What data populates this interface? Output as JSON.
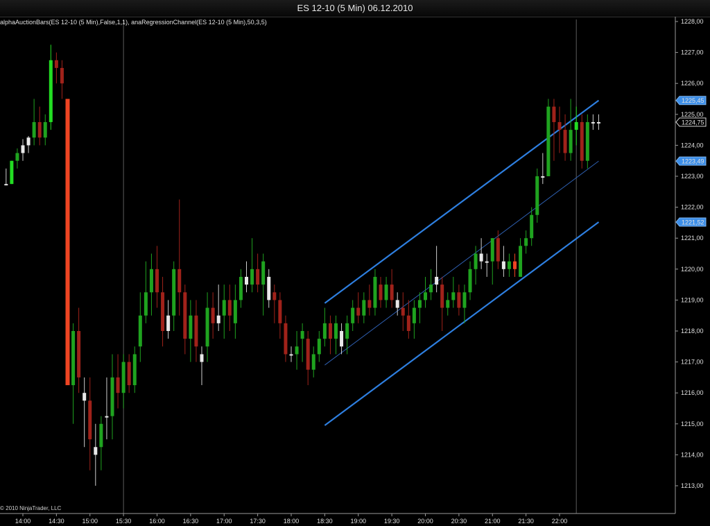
{
  "window": {
    "title": "ES 12-10 (5 Min)  06.12.2010"
  },
  "indicator_label": "alphaAuctionBars(ES 12-10 (5 Min),False,1,1), anaRegressionChannel(ES 12-10 (5 Min),50,3,5)",
  "copyright": "© 2010 NinjaTrader, LLC",
  "price_markers": [
    {
      "label": "1225,45",
      "value": 1225.45,
      "style": "blue"
    },
    {
      "label": "1224,75",
      "value": 1224.75,
      "style": "last"
    },
    {
      "label": "1223,49",
      "value": 1223.49,
      "style": "blue"
    },
    {
      "label": "1221,52",
      "value": 1221.52,
      "style": "blue"
    }
  ],
  "colors": {
    "background": "#000000",
    "up_candle": "#1fa31f",
    "down_candle": "#a0221a",
    "highlight_up": "#22dd22",
    "highlight_down": "#ee4422",
    "doji": "#e8e8e8",
    "channel": "#2e7fe0",
    "midline": "#2e5fb0",
    "marker_fill": "#3c8ee8"
  },
  "chart_data": {
    "type": "candlestick",
    "title": "ES 12-10 (5 Min)  06.12.2010",
    "ylim": [
      1212.5,
      1228.5
    ],
    "y_ticks": [
      "1228,00",
      "1227,00",
      "1226,00",
      "1225,00",
      "1224,00",
      "1223,00",
      "1222,00",
      "1221,00",
      "1220,00",
      "1219,00",
      "1218,00",
      "1217,00",
      "1216,00",
      "1215,00",
      "1214,00",
      "1213,00"
    ],
    "y_tick_values": [
      1228,
      1227,
      1226,
      1225,
      1224,
      1223,
      1222,
      1221,
      1220,
      1219,
      1218,
      1217,
      1216,
      1215,
      1214,
      1213
    ],
    "x_ticks": [
      "14:00",
      "14:30",
      "15:00",
      "15:30",
      "16:00",
      "16:30",
      "17:00",
      "17:30",
      "18:00",
      "18:30",
      "19:00",
      "19:30",
      "20:00",
      "20:30",
      "21:00",
      "21:30",
      "22:00"
    ],
    "x_tick_minutes": [
      840,
      870,
      900,
      930,
      960,
      990,
      1020,
      1050,
      1080,
      1110,
      1140,
      1170,
      1200,
      1230,
      1260,
      1290,
      1320
    ],
    "session_breaks": [
      "15:30",
      "22:15"
    ],
    "candles": [
      [
        "13:45",
        1222.75,
        1223.25,
        1222.75,
        1222.75,
        "doji"
      ],
      [
        "13:50",
        1222.75,
        1223.5,
        1222.75,
        1223.5,
        "hi_up"
      ],
      [
        "13:55",
        1223.5,
        1223.9,
        1223.25,
        1223.75,
        "up"
      ],
      [
        "14:00",
        1223.75,
        1224.2,
        1223.5,
        1224.0,
        "doji"
      ],
      [
        "14:05",
        1224.0,
        1224.3,
        1223.75,
        1224.25,
        "doji"
      ],
      [
        "14:10",
        1224.25,
        1225.5,
        1224.0,
        1224.75,
        "up"
      ],
      [
        "14:15",
        1224.75,
        1225.25,
        1224.0,
        1224.25,
        "down"
      ],
      [
        "14:20",
        1224.25,
        1225.0,
        1224.0,
        1224.75,
        "up"
      ],
      [
        "14:25",
        1224.75,
        1227.25,
        1224.5,
        1226.75,
        "hi_up"
      ],
      [
        "14:30",
        1226.75,
        1227.0,
        1226.0,
        1226.5,
        "down"
      ],
      [
        "14:35",
        1226.5,
        1226.75,
        1225.5,
        1226.0,
        "down"
      ],
      [
        "14:40",
        1225.5,
        1225.5,
        1216.25,
        1216.25,
        "hi_down"
      ],
      [
        "14:45",
        1216.25,
        1218.25,
        1215.0,
        1218.0,
        "up"
      ],
      [
        "14:50",
        1218.0,
        1218.75,
        1216.0,
        1216.5,
        "down"
      ],
      [
        "14:55",
        1216.0,
        1216.5,
        1214.25,
        1215.75,
        "doji"
      ],
      [
        "15:00",
        1215.75,
        1216.5,
        1213.5,
        1214.5,
        "down"
      ],
      [
        "15:05",
        1214.0,
        1215.0,
        1213.0,
        1214.25,
        "doji"
      ],
      [
        "15:10",
        1214.25,
        1215.25,
        1213.5,
        1215.0,
        "up"
      ],
      [
        "15:15",
        1215.25,
        1216.5,
        1214.5,
        1215.25,
        "doji"
      ],
      [
        "15:20",
        1215.25,
        1217.25,
        1214.5,
        1216.5,
        "up"
      ],
      [
        "15:25",
        1216.5,
        1217.25,
        1215.5,
        1216.0,
        "down"
      ],
      [
        "15:30",
        1216.0,
        1217.25,
        1215.5,
        1217.0,
        "up"
      ],
      [
        "15:35",
        1217.0,
        1217.25,
        1216.0,
        1216.25,
        "down"
      ],
      [
        "15:40",
        1216.25,
        1217.5,
        1216.0,
        1217.25,
        "up"
      ],
      [
        "15:45",
        1217.5,
        1219.25,
        1217.0,
        1218.5,
        "up"
      ],
      [
        "15:50",
        1218.5,
        1220.25,
        1218.25,
        1219.25,
        "up"
      ],
      [
        "15:55",
        1219.25,
        1220.5,
        1218.5,
        1220.0,
        "up"
      ],
      [
        "16:00",
        1220.0,
        1220.75,
        1218.75,
        1219.25,
        "down"
      ],
      [
        "16:05",
        1219.25,
        1219.75,
        1217.5,
        1218.0,
        "down"
      ],
      [
        "16:10",
        1218.0,
        1219.0,
        1217.75,
        1218.5,
        "doji"
      ],
      [
        "16:15",
        1218.5,
        1220.25,
        1218.0,
        1220.0,
        "up"
      ],
      [
        "16:20",
        1220.0,
        1222.25,
        1218.5,
        1219.25,
        "down"
      ],
      [
        "16:25",
        1219.25,
        1219.5,
        1217.25,
        1217.75,
        "down"
      ],
      [
        "16:30",
        1217.75,
        1219.0,
        1217.0,
        1218.5,
        "up"
      ],
      [
        "16:35",
        1218.5,
        1219.0,
        1217.0,
        1217.5,
        "down"
      ],
      [
        "16:40",
        1217.0,
        1217.5,
        1216.25,
        1217.25,
        "doji"
      ],
      [
        "16:45",
        1217.5,
        1219.25,
        1217.0,
        1218.75,
        "up"
      ],
      [
        "16:50",
        1218.75,
        1219.25,
        1217.75,
        1218.25,
        "down"
      ],
      [
        "16:55",
        1218.25,
        1219.5,
        1218.0,
        1218.5,
        "doji"
      ],
      [
        "17:00",
        1218.5,
        1219.5,
        1217.75,
        1219.0,
        "up"
      ],
      [
        "17:05",
        1219.0,
        1219.5,
        1218.0,
        1218.5,
        "down"
      ],
      [
        "17:10",
        1218.25,
        1219.5,
        1217.75,
        1219.0,
        "up"
      ],
      [
        "17:15",
        1219.0,
        1220.0,
        1218.75,
        1219.75,
        "up"
      ],
      [
        "17:20",
        1219.75,
        1220.25,
        1219.25,
        1219.5,
        "doji"
      ],
      [
        "17:25",
        1219.5,
        1221.0,
        1219.25,
        1220.0,
        "up"
      ],
      [
        "17:30",
        1220.0,
        1220.5,
        1219.25,
        1219.5,
        "down"
      ],
      [
        "17:35",
        1219.5,
        1220.5,
        1218.5,
        1220.25,
        "up"
      ],
      [
        "17:40",
        1219.75,
        1220.0,
        1218.75,
        1219.0,
        "doji"
      ],
      [
        "17:45",
        1219.25,
        1219.5,
        1218.25,
        1219.0,
        "down"
      ],
      [
        "17:50",
        1219.0,
        1219.25,
        1217.75,
        1218.25,
        "down"
      ],
      [
        "17:55",
        1218.25,
        1218.5,
        1217.0,
        1217.25,
        "down"
      ],
      [
        "18:00",
        1217.25,
        1217.5,
        1217.0,
        1217.25,
        "doji"
      ],
      [
        "18:05",
        1217.25,
        1218.0,
        1216.75,
        1217.5,
        "up"
      ],
      [
        "18:10",
        1217.75,
        1218.25,
        1217.0,
        1218.0,
        "up"
      ],
      [
        "18:15",
        1217.75,
        1218.0,
        1216.25,
        1216.75,
        "down"
      ],
      [
        "18:20",
        1216.75,
        1217.5,
        1216.5,
        1217.25,
        "up"
      ],
      [
        "18:25",
        1217.25,
        1218.0,
        1217.0,
        1217.75,
        "up"
      ],
      [
        "18:30",
        1217.75,
        1218.75,
        1217.5,
        1218.25,
        "up"
      ],
      [
        "18:35",
        1218.25,
        1218.5,
        1217.25,
        1217.75,
        "down"
      ],
      [
        "18:40",
        1217.75,
        1218.5,
        1217.25,
        1218.25,
        "up"
      ],
      [
        "18:45",
        1218.0,
        1218.25,
        1217.25,
        1217.5,
        "doji"
      ],
      [
        "18:50",
        1217.75,
        1218.5,
        1217.25,
        1218.25,
        "up"
      ],
      [
        "18:55",
        1218.25,
        1219.0,
        1218.0,
        1218.75,
        "up"
      ],
      [
        "19:00",
        1218.75,
        1219.25,
        1218.25,
        1218.5,
        "down"
      ],
      [
        "19:05",
        1218.5,
        1219.25,
        1218.25,
        1219.0,
        "up"
      ],
      [
        "19:10",
        1219.0,
        1219.5,
        1218.5,
        1218.75,
        "down"
      ],
      [
        "19:15",
        1218.75,
        1220.0,
        1218.5,
        1219.75,
        "up"
      ],
      [
        "19:20",
        1219.5,
        1219.75,
        1218.75,
        1219.0,
        "down"
      ],
      [
        "19:25",
        1219.0,
        1219.75,
        1218.75,
        1219.5,
        "up"
      ],
      [
        "19:30",
        1219.5,
        1220.0,
        1218.75,
        1219.0,
        "down"
      ],
      [
        "19:35",
        1219.0,
        1219.25,
        1218.5,
        1218.75,
        "doji"
      ],
      [
        "19:40",
        1218.75,
        1219.25,
        1218.0,
        1218.5,
        "down"
      ],
      [
        "19:45",
        1218.5,
        1219.0,
        1217.75,
        1218.0,
        "down"
      ],
      [
        "19:50",
        1218.25,
        1219.0,
        1217.75,
        1218.75,
        "up"
      ],
      [
        "19:55",
        1218.75,
        1219.25,
        1218.25,
        1219.0,
        "up"
      ],
      [
        "20:00",
        1219.0,
        1219.75,
        1218.75,
        1219.25,
        "up"
      ],
      [
        "20:05",
        1219.25,
        1220.0,
        1219.0,
        1219.5,
        "up"
      ],
      [
        "20:10",
        1219.5,
        1220.75,
        1219.25,
        1219.75,
        "doji"
      ],
      [
        "20:15",
        1219.5,
        1219.75,
        1218.0,
        1218.75,
        "down"
      ],
      [
        "20:20",
        1218.75,
        1219.25,
        1218.5,
        1219.0,
        "up"
      ],
      [
        "20:25",
        1219.0,
        1219.75,
        1218.75,
        1219.25,
        "up"
      ],
      [
        "20:30",
        1219.25,
        1219.5,
        1218.5,
        1218.75,
        "down"
      ],
      [
        "20:35",
        1218.75,
        1219.5,
        1218.25,
        1219.25,
        "up"
      ],
      [
        "20:40",
        1219.25,
        1220.25,
        1219.0,
        1220.0,
        "up"
      ],
      [
        "20:45",
        1220.0,
        1220.75,
        1219.5,
        1220.5,
        "up"
      ],
      [
        "20:50",
        1220.5,
        1221.0,
        1220.0,
        1220.25,
        "doji"
      ],
      [
        "20:55",
        1220.25,
        1220.5,
        1219.75,
        1220.25,
        "doji"
      ],
      [
        "21:00",
        1220.25,
        1221.0,
        1219.5,
        1221.0,
        "up"
      ],
      [
        "21:05",
        1221.0,
        1221.25,
        1220.0,
        1220.25,
        "down"
      ],
      [
        "21:10",
        1220.25,
        1220.75,
        1219.75,
        1220.0,
        "doji"
      ],
      [
        "21:15",
        1220.0,
        1220.5,
        1219.75,
        1220.25,
        "up"
      ],
      [
        "21:20",
        1220.25,
        1220.5,
        1219.75,
        1220.0,
        "hi_down"
      ],
      [
        "21:25",
        1219.75,
        1221.0,
        1219.75,
        1220.75,
        "up"
      ],
      [
        "21:30",
        1220.75,
        1221.25,
        1220.5,
        1221.0,
        "up"
      ],
      [
        "21:35",
        1221.0,
        1222.0,
        1220.75,
        1221.75,
        "up"
      ],
      [
        "21:40",
        1221.75,
        1223.25,
        1221.5,
        1223.0,
        "up"
      ],
      [
        "21:45",
        1223.0,
        1223.75,
        1222.75,
        1223.0,
        "doji"
      ],
      [
        "21:50",
        1223.0,
        1225.5,
        1223.0,
        1225.25,
        "up"
      ],
      [
        "21:55",
        1225.25,
        1225.5,
        1223.5,
        1224.75,
        "down"
      ],
      [
        "22:00",
        1224.75,
        1225.25,
        1223.75,
        1224.5,
        "down"
      ],
      [
        "22:05",
        1224.5,
        1225.0,
        1223.5,
        1223.75,
        "down"
      ],
      [
        "22:10",
        1223.75,
        1225.5,
        1223.5,
        1224.5,
        "up"
      ],
      [
        "22:15",
        1224.5,
        1225.25,
        1224.0,
        1224.75,
        "hi_up"
      ],
      [
        "22:20",
        1224.75,
        1225.0,
        1223.25,
        1223.5,
        "down"
      ],
      [
        "22:25",
        1223.5,
        1225.0,
        1223.25,
        1224.75,
        "up"
      ],
      [
        "22:30",
        1224.75,
        1225.0,
        1224.5,
        1224.75,
        "doji"
      ],
      [
        "22:35",
        1224.75,
        1225.0,
        1224.5,
        1224.75,
        "doji"
      ]
    ],
    "regression_channel": {
      "start_time": "18:30",
      "end_time": "22:35",
      "upper": [
        1218.9,
        1225.45
      ],
      "middle": [
        1216.9,
        1223.49
      ],
      "lower": [
        1214.95,
        1221.52
      ]
    }
  }
}
